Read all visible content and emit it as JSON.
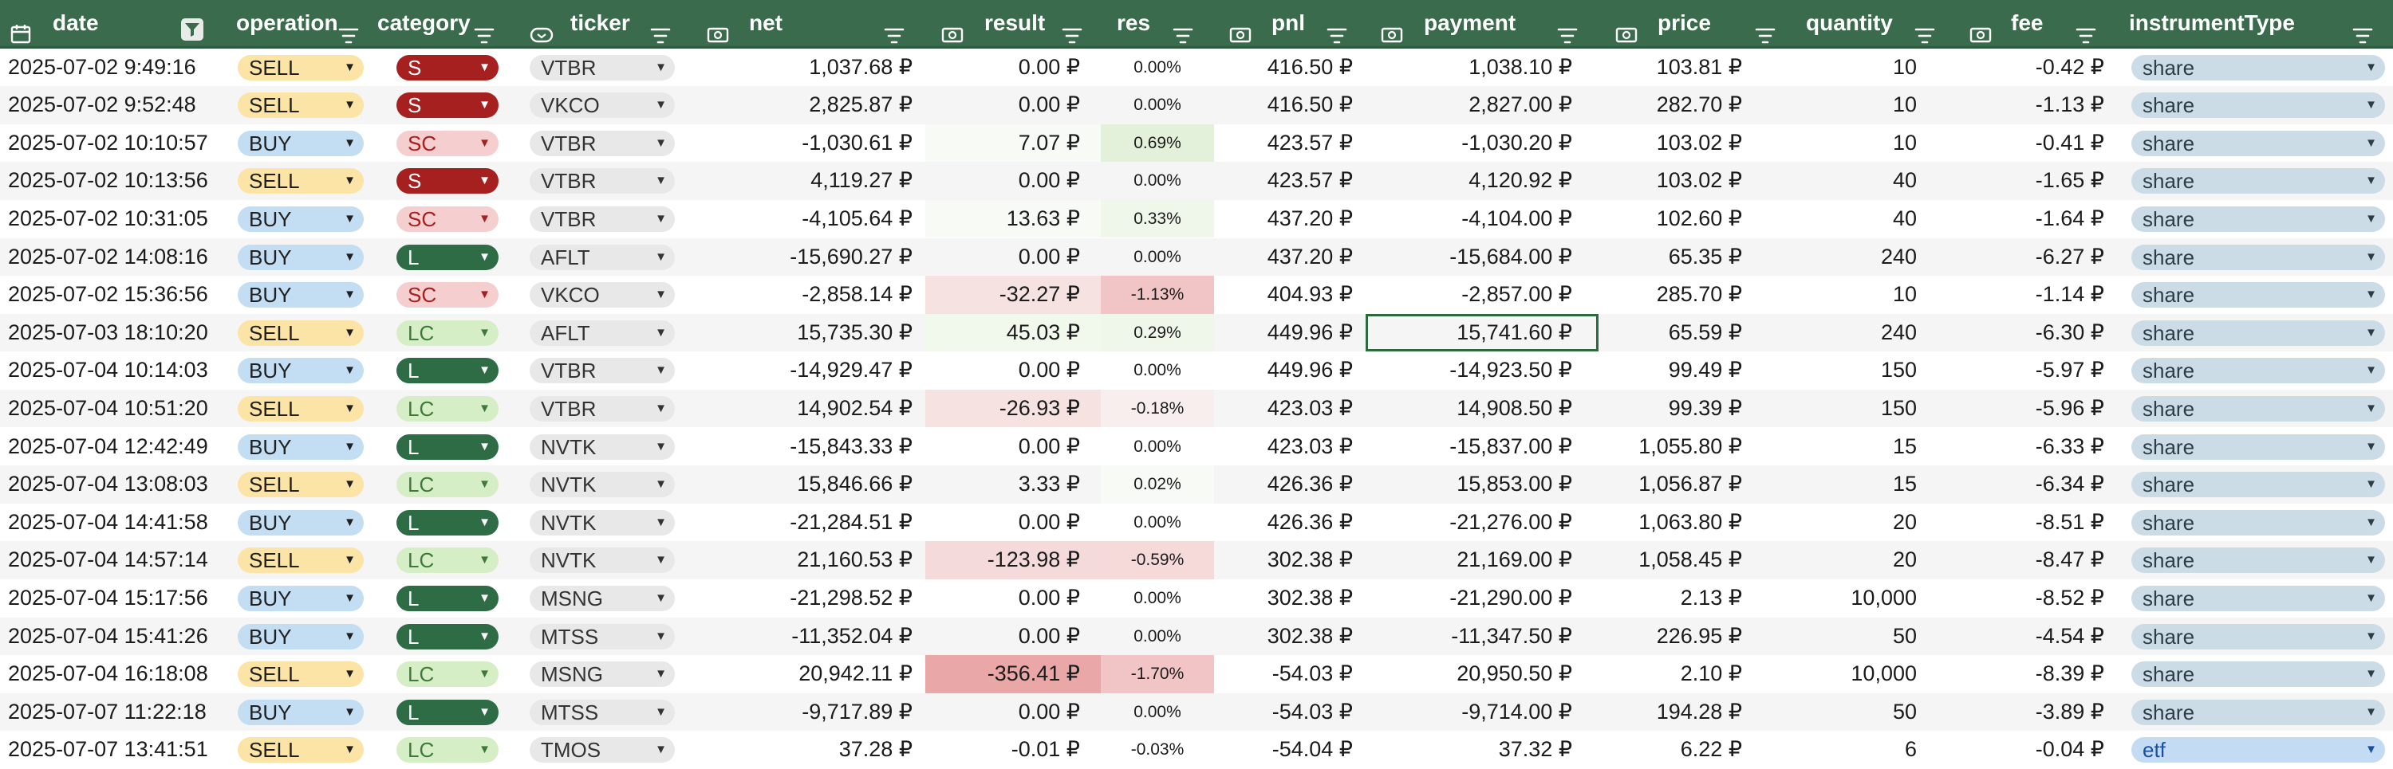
{
  "columns": [
    {
      "key": "date",
      "label": "date",
      "icon": "calendar-icon"
    },
    {
      "key": "operation",
      "label": "operation",
      "icon": "filter-icon"
    },
    {
      "key": "category",
      "label": "category",
      "icon": "filter-icon"
    },
    {
      "key": "ticker",
      "label": "ticker",
      "icon": "dropdown-chip-icon"
    },
    {
      "key": "net",
      "label": "net",
      "icon": "currency-icon"
    },
    {
      "key": "result",
      "label": "result",
      "icon": "currency-icon"
    },
    {
      "key": "res",
      "label": "res",
      "icon": "filter-icon"
    },
    {
      "key": "pnl",
      "label": "pnl",
      "icon": "currency-icon"
    },
    {
      "key": "payment",
      "label": "payment",
      "icon": "currency-icon"
    },
    {
      "key": "price",
      "label": "price",
      "icon": "currency-icon"
    },
    {
      "key": "quantity",
      "label": "quantity",
      "icon": "filter-icon"
    },
    {
      "key": "fee",
      "label": "fee",
      "icon": "currency-icon"
    },
    {
      "key": "instrumentType",
      "label": "instrumentType",
      "icon": "filter-icon"
    }
  ],
  "colors": {
    "header_bg": "#3a6b4d",
    "res_pos": "#e3f1da",
    "res_neg": "#f1c5c5",
    "result_neg_light": "#f7e2e2",
    "result_neg_dark": "#e9a7a7",
    "selected_border": "#2c6a3e"
  },
  "rows": [
    {
      "date": "2025-07-02 9:49:16",
      "operation": "SELL",
      "category": "S",
      "ticker": "VTBR",
      "net": "1,037.68 ₽",
      "result": "0.00 ₽",
      "res": "0.00%",
      "pnl": "416.50 ₽",
      "payment": "1,038.10 ₽",
      "price": "103.81 ₽",
      "quantity": "10",
      "fee": "-0.42 ₽",
      "instrumentType": "share"
    },
    {
      "date": "2025-07-02 9:52:48",
      "operation": "SELL",
      "category": "S",
      "ticker": "VKCO",
      "net": "2,825.87 ₽",
      "result": "0.00 ₽",
      "res": "0.00%",
      "pnl": "416.50 ₽",
      "payment": "2,827.00 ₽",
      "price": "282.70 ₽",
      "quantity": "10",
      "fee": "-1.13 ₽",
      "instrumentType": "share"
    },
    {
      "date": "2025-07-02 10:10:57",
      "operation": "BUY",
      "category": "SC",
      "ticker": "VTBR",
      "net": "-1,030.61 ₽",
      "result": "7.07 ₽",
      "res": "0.69%",
      "pnl": "423.57 ₽",
      "payment": "-1,030.20 ₽",
      "price": "103.02 ₽",
      "quantity": "10",
      "fee": "-0.41 ₽",
      "instrumentType": "share"
    },
    {
      "date": "2025-07-02 10:13:56",
      "operation": "SELL",
      "category": "S",
      "ticker": "VTBR",
      "net": "4,119.27 ₽",
      "result": "0.00 ₽",
      "res": "0.00%",
      "pnl": "423.57 ₽",
      "payment": "4,120.92 ₽",
      "price": "103.02 ₽",
      "quantity": "40",
      "fee": "-1.65 ₽",
      "instrumentType": "share"
    },
    {
      "date": "2025-07-02 10:31:05",
      "operation": "BUY",
      "category": "SC",
      "ticker": "VTBR",
      "net": "-4,105.64 ₽",
      "result": "13.63 ₽",
      "res": "0.33%",
      "pnl": "437.20 ₽",
      "payment": "-4,104.00 ₽",
      "price": "102.60 ₽",
      "quantity": "40",
      "fee": "-1.64 ₽",
      "instrumentType": "share"
    },
    {
      "date": "2025-07-02 14:08:16",
      "operation": "BUY",
      "category": "L",
      "ticker": "AFLT",
      "net": "-15,690.27 ₽",
      "result": "0.00 ₽",
      "res": "0.00%",
      "pnl": "437.20 ₽",
      "payment": "-15,684.00 ₽",
      "price": "65.35 ₽",
      "quantity": "240",
      "fee": "-6.27 ₽",
      "instrumentType": "share"
    },
    {
      "date": "2025-07-02 15:36:56",
      "operation": "BUY",
      "category": "SC",
      "ticker": "VKCO",
      "net": "-2,858.14 ₽",
      "result": "-32.27 ₽",
      "res": "-1.13%",
      "pnl": "404.93 ₽",
      "payment": "-2,857.00 ₽",
      "price": "285.70 ₽",
      "quantity": "10",
      "fee": "-1.14 ₽",
      "instrumentType": "share"
    },
    {
      "date": "2025-07-03 18:10:20",
      "operation": "SELL",
      "category": "LC",
      "ticker": "AFLT",
      "net": "15,735.30 ₽",
      "result": "45.03 ₽",
      "res": "0.29%",
      "pnl": "449.96 ₽",
      "payment": "15,741.60 ₽",
      "price": "65.59 ₽",
      "quantity": "240",
      "fee": "-6.30 ₽",
      "instrumentType": "share"
    },
    {
      "date": "2025-07-04 10:14:03",
      "operation": "BUY",
      "category": "L",
      "ticker": "VTBR",
      "net": "-14,929.47 ₽",
      "result": "0.00 ₽",
      "res": "0.00%",
      "pnl": "449.96 ₽",
      "payment": "-14,923.50 ₽",
      "price": "99.49 ₽",
      "quantity": "150",
      "fee": "-5.97 ₽",
      "instrumentType": "share"
    },
    {
      "date": "2025-07-04 10:51:20",
      "operation": "SELL",
      "category": "LC",
      "ticker": "VTBR",
      "net": "14,902.54 ₽",
      "result": "-26.93 ₽",
      "res": "-0.18%",
      "pnl": "423.03 ₽",
      "payment": "14,908.50 ₽",
      "price": "99.39 ₽",
      "quantity": "150",
      "fee": "-5.96 ₽",
      "instrumentType": "share"
    },
    {
      "date": "2025-07-04 12:42:49",
      "operation": "BUY",
      "category": "L",
      "ticker": "NVTK",
      "net": "-15,843.33 ₽",
      "result": "0.00 ₽",
      "res": "0.00%",
      "pnl": "423.03 ₽",
      "payment": "-15,837.00 ₽",
      "price": "1,055.80 ₽",
      "quantity": "15",
      "fee": "-6.33 ₽",
      "instrumentType": "share"
    },
    {
      "date": "2025-07-04 13:08:03",
      "operation": "SELL",
      "category": "LC",
      "ticker": "NVTK",
      "net": "15,846.66 ₽",
      "result": "3.33 ₽",
      "res": "0.02%",
      "pnl": "426.36 ₽",
      "payment": "15,853.00 ₽",
      "price": "1,056.87 ₽",
      "quantity": "15",
      "fee": "-6.34 ₽",
      "instrumentType": "share"
    },
    {
      "date": "2025-07-04 14:41:58",
      "operation": "BUY",
      "category": "L",
      "ticker": "NVTK",
      "net": "-21,284.51 ₽",
      "result": "0.00 ₽",
      "res": "0.00%",
      "pnl": "426.36 ₽",
      "payment": "-21,276.00 ₽",
      "price": "1,063.80 ₽",
      "quantity": "20",
      "fee": "-8.51 ₽",
      "instrumentType": "share"
    },
    {
      "date": "2025-07-04 14:57:14",
      "operation": "SELL",
      "category": "LC",
      "ticker": "NVTK",
      "net": "21,160.53 ₽",
      "result": "-123.98 ₽",
      "res": "-0.59%",
      "pnl": "302.38 ₽",
      "payment": "21,169.00 ₽",
      "price": "1,058.45 ₽",
      "quantity": "20",
      "fee": "-8.47 ₽",
      "instrumentType": "share"
    },
    {
      "date": "2025-07-04 15:17:56",
      "operation": "BUY",
      "category": "L",
      "ticker": "MSNG",
      "net": "-21,298.52 ₽",
      "result": "0.00 ₽",
      "res": "0.00%",
      "pnl": "302.38 ₽",
      "payment": "-21,290.00 ₽",
      "price": "2.13 ₽",
      "quantity": "10,000",
      "fee": "-8.52 ₽",
      "instrumentType": "share"
    },
    {
      "date": "2025-07-04 15:41:26",
      "operation": "BUY",
      "category": "L",
      "ticker": "MTSS",
      "net": "-11,352.04 ₽",
      "result": "0.00 ₽",
      "res": "0.00%",
      "pnl": "302.38 ₽",
      "payment": "-11,347.50 ₽",
      "price": "226.95 ₽",
      "quantity": "50",
      "fee": "-4.54 ₽",
      "instrumentType": "share"
    },
    {
      "date": "2025-07-04 16:18:08",
      "operation": "SELL",
      "category": "LC",
      "ticker": "MSNG",
      "net": "20,942.11 ₽",
      "result": "-356.41 ₽",
      "res": "-1.70%",
      "pnl": "-54.03 ₽",
      "payment": "20,950.50 ₽",
      "price": "2.10 ₽",
      "quantity": "10,000",
      "fee": "-8.39 ₽",
      "instrumentType": "share"
    },
    {
      "date": "2025-07-07 11:22:18",
      "operation": "BUY",
      "category": "L",
      "ticker": "MTSS",
      "net": "-9,717.89 ₽",
      "result": "0.00 ₽",
      "res": "0.00%",
      "pnl": "-54.03 ₽",
      "payment": "-9,714.00 ₽",
      "price": "194.28 ₽",
      "quantity": "50",
      "fee": "-3.89 ₽",
      "instrumentType": "share"
    },
    {
      "date": "2025-07-07 13:41:51",
      "operation": "SELL",
      "category": "LC",
      "ticker": "TMOS",
      "net": "37.28 ₽",
      "result": "-0.01 ₽",
      "res": "-0.03%",
      "pnl": "-54.04 ₽",
      "payment": "37.32 ₽",
      "price": "6.22 ₽",
      "quantity": "6",
      "fee": "-0.04 ₽",
      "instrumentType": "etf"
    }
  ]
}
